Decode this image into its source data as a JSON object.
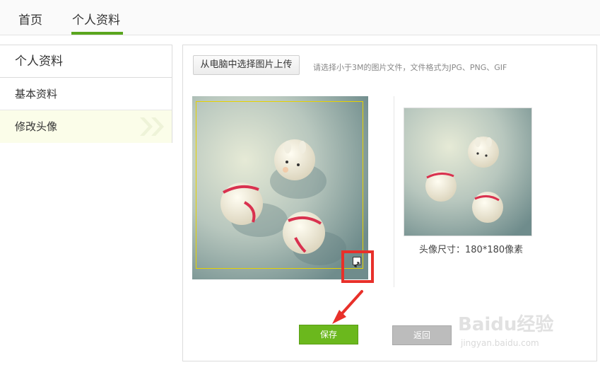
{
  "topnav": {
    "home_label": "首页",
    "profile_label": "个人资料",
    "active_color": "#5aa61e"
  },
  "sidebar": {
    "title": "个人资料",
    "items": [
      {
        "label": "基本资料",
        "active": false
      },
      {
        "label": "修改头像",
        "active": true
      }
    ]
  },
  "upload": {
    "button_label": "从电脑中选择图片上传",
    "hint": "请选择小于3M的图片文件，文件格式为JPG、PNG、GIF"
  },
  "preview": {
    "size_label": "头像尺寸：180*180像素"
  },
  "actions": {
    "save_label": "保存",
    "back_label": "返回"
  },
  "watermark": {
    "logo": "Baidu经验",
    "url": "jingyan.baidu.com"
  }
}
